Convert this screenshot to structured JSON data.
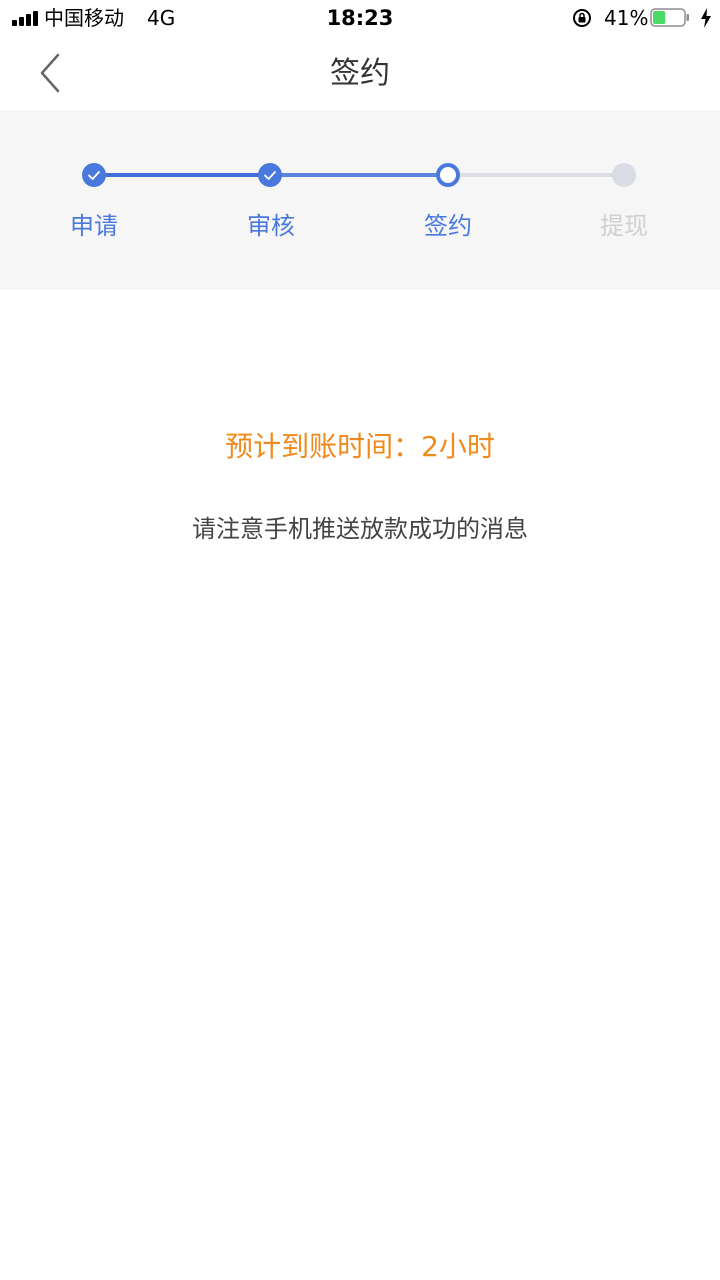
{
  "status_bar": {
    "carrier": "中国移动",
    "network": "4G",
    "time": "18:23",
    "battery_percent": "41%",
    "battery_level": 0.41,
    "battery_color": "#4cd964"
  },
  "nav": {
    "title": "签约",
    "back_icon": "chevron-left-icon"
  },
  "steps": {
    "current_index": 2,
    "items": [
      {
        "label": "申请",
        "state": "done"
      },
      {
        "label": "审核",
        "state": "done"
      },
      {
        "label": "签约",
        "state": "current"
      },
      {
        "label": "提现",
        "state": "pending"
      }
    ],
    "active_color": "#4a79de",
    "pending_color": "#d9dce3"
  },
  "content": {
    "eta_text": "预计到账时间：2小时",
    "eta_color": "#f08a1c",
    "notice_text": "请注意手机推送放款成功的消息"
  }
}
